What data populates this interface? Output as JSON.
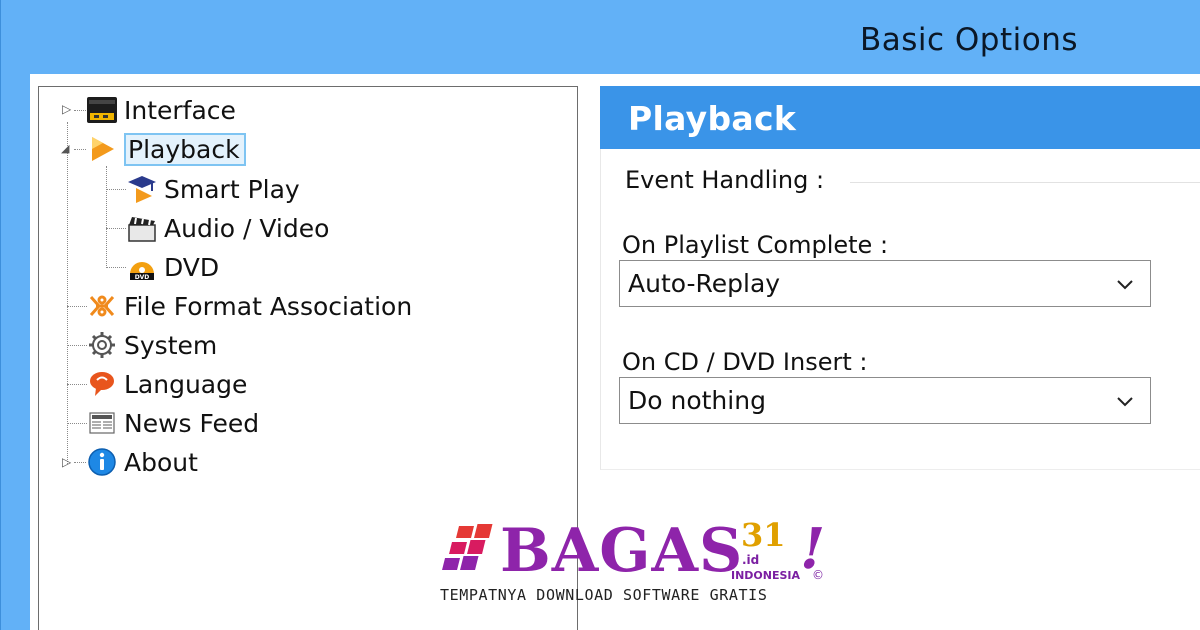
{
  "window": {
    "title": "Basic Options"
  },
  "tree": {
    "items": [
      {
        "label": "Interface",
        "icon": "interface-icon",
        "expander": "▷"
      },
      {
        "label": "Playback",
        "icon": "playback-icon",
        "expander": "◢",
        "selected": true
      },
      {
        "label": "Smart Play",
        "icon": "smart-play-icon"
      },
      {
        "label": "Audio / Video",
        "icon": "clapperboard-icon"
      },
      {
        "label": "DVD",
        "icon": "dvd-icon"
      },
      {
        "label": "File Format Association",
        "icon": "file-format-icon"
      },
      {
        "label": "System",
        "icon": "gear-icon"
      },
      {
        "label": "Language",
        "icon": "language-icon"
      },
      {
        "label": "News Feed",
        "icon": "news-feed-icon"
      },
      {
        "label": "About",
        "icon": "info-icon",
        "expander": "▷"
      }
    ]
  },
  "panel": {
    "header": "Playback",
    "group_label": "Event Handling :",
    "fields": [
      {
        "label": "On Playlist Complete :",
        "value": "Auto-Replay"
      },
      {
        "label": "On CD / DVD Insert :",
        "value": "Do nothing"
      }
    ]
  },
  "watermark": {
    "brand": "BAGAS",
    "number": "31",
    "domain": ".id",
    "country": "INDONESIA",
    "exclaim": "!",
    "copyright": "©",
    "tagline": "TEMPATNYA DOWNLOAD SOFTWARE GRATIS"
  },
  "colors": {
    "title_bar": "#62b1f7",
    "section_header": "#3a94e8",
    "selection_border": "#7ec4f2",
    "watermark_purple": "#8e24aa",
    "watermark_gold": "#e0a000"
  }
}
